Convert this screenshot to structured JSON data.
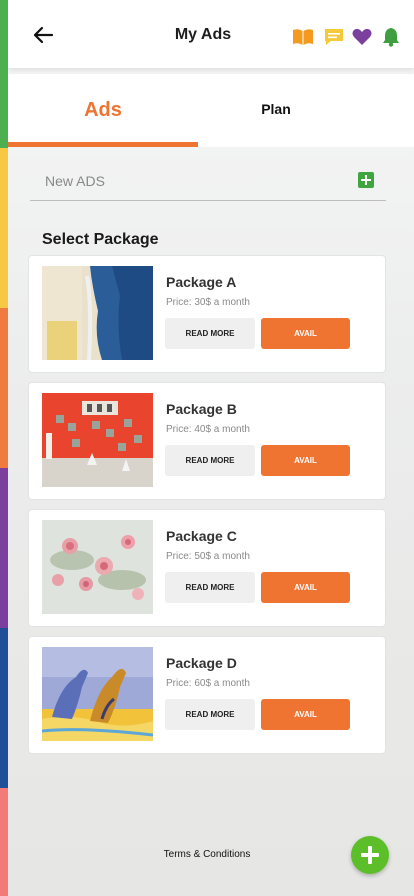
{
  "header": {
    "title": "My Ads",
    "back_icon": "arrow-left-icon",
    "icons": [
      "book-icon",
      "chat-icon",
      "heart-icon",
      "bell-icon"
    ]
  },
  "tabs": [
    {
      "label": "Ads",
      "active": true
    },
    {
      "label": "Plan",
      "active": false
    }
  ],
  "new_ads": {
    "label": "New ADS",
    "icon": "add-square-icon"
  },
  "section_title": "Select Package",
  "packages": [
    {
      "name": "Package A",
      "price": "Price: 30$ a month",
      "read_more": "READ MORE",
      "avail": "AVAIL"
    },
    {
      "name": "Package B",
      "price": "Price: 40$ a month",
      "read_more": "READ MORE",
      "avail": "AVAIL"
    },
    {
      "name": "Package C",
      "price": "Price: 50$ a month",
      "read_more": "READ MORE",
      "avail": "AVAIL"
    },
    {
      "name": "Package D",
      "price": "Price: 60$ a month",
      "read_more": "READ MORE",
      "avail": "AVAIL"
    }
  ],
  "footer": {
    "terms": "Terms & Conditions",
    "fab_icon": "plus-icon"
  },
  "colors": {
    "accent": "#ef7432",
    "green": "#5cbf2a",
    "side_stripes": [
      "#4caf50",
      "#f7c843",
      "#f07b3f",
      "#7b3f9e",
      "#1f4f96",
      "#f47a7a"
    ]
  }
}
